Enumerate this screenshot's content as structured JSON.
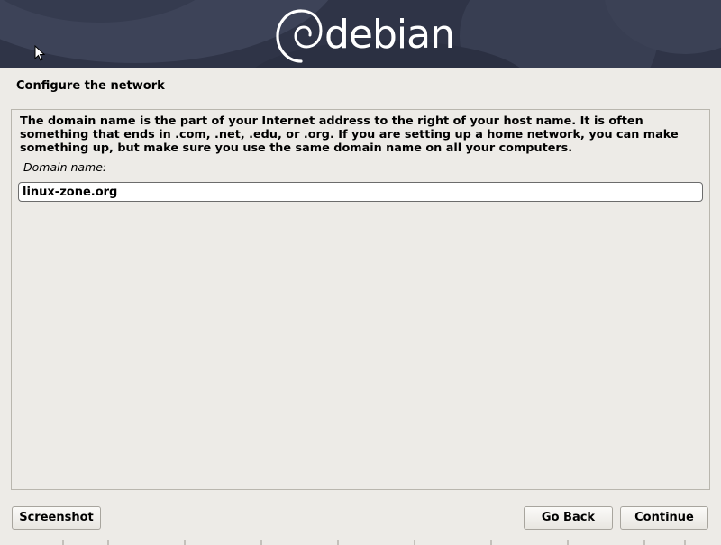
{
  "banner": {
    "logo_text": "debian",
    "logo_icon": "debian-swirl-icon"
  },
  "page": {
    "title": "Configure the network"
  },
  "form": {
    "description": "The domain name is the part of your Internet address to the right of your host name.  It is often\nsomething that ends in .com, .net, .edu, or .org.  If you are setting up a home network, you can make\nsomething up, but make sure you use the same domain name on all your computers.",
    "domain_label": "Domain name:",
    "domain_value": "linux-zone.org"
  },
  "buttons": {
    "screenshot": "Screenshot",
    "go_back": "Go Back",
    "continue": "Continue"
  },
  "colors": {
    "banner_bg": "#2f3447",
    "page_bg": "#edebe7",
    "border": "#b9b6ae"
  }
}
